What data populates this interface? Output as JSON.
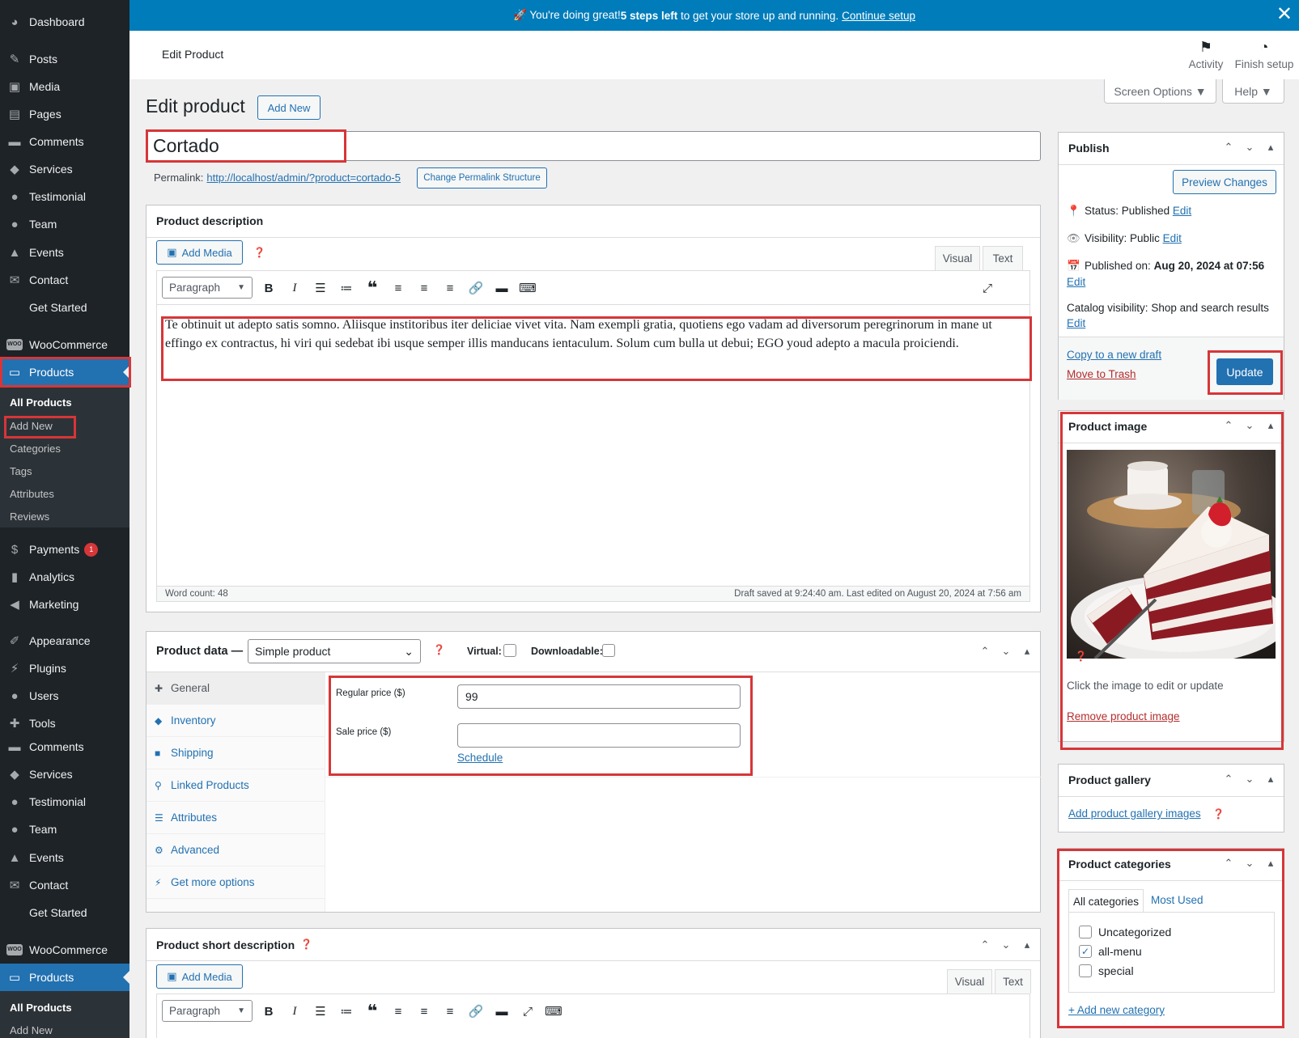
{
  "banner": {
    "text_prefix": "🚀 You're doing great! ",
    "text_bold": "5 steps left",
    "text_suffix": " to get your store up and running.",
    "link": "Continue setup"
  },
  "sidebar": {
    "top_items": [
      {
        "label": "Dashboard",
        "icon": "dashboard-icon"
      },
      {
        "label": "Posts",
        "icon": "pin-icon"
      },
      {
        "label": "Media",
        "icon": "media-icon"
      },
      {
        "label": "Pages",
        "icon": "pages-icon"
      },
      {
        "label": "Comments",
        "icon": "comment-icon"
      },
      {
        "label": "Services",
        "icon": "tag-icon"
      },
      {
        "label": "Testimonial",
        "icon": "user-icon"
      },
      {
        "label": "Team",
        "icon": "user-icon"
      },
      {
        "label": "Events",
        "icon": "graduation-icon"
      },
      {
        "label": "Contact",
        "icon": "mail-icon"
      },
      {
        "label": "Get Started",
        "icon": ""
      },
      {
        "label": "WooCommerce",
        "icon": "woo-icon"
      },
      {
        "label": "Products",
        "icon": "archive-icon"
      }
    ],
    "product_sub": [
      "All Products",
      "Add New",
      "Categories",
      "Tags",
      "Attributes",
      "Reviews"
    ],
    "bottom_items": [
      {
        "label": "Payments",
        "icon": "dollar-icon",
        "badge": "1"
      },
      {
        "label": "Analytics",
        "icon": "chart-icon"
      },
      {
        "label": "Marketing",
        "icon": "megaphone-icon"
      },
      {
        "label": "Appearance",
        "icon": "brush-icon"
      },
      {
        "label": "Plugins",
        "icon": "plug-icon"
      },
      {
        "label": "Users",
        "icon": "user-icon"
      },
      {
        "label": "Tools",
        "icon": "wrench-icon"
      },
      {
        "label": "Comments",
        "icon": "comment-icon"
      },
      {
        "label": "Services",
        "icon": "tag-icon"
      },
      {
        "label": "Testimonial",
        "icon": "user-icon"
      },
      {
        "label": "Team",
        "icon": "user-icon"
      },
      {
        "label": "Events",
        "icon": "graduation-icon"
      },
      {
        "label": "Contact",
        "icon": "mail-icon"
      },
      {
        "label": "Get Started",
        "icon": ""
      },
      {
        "label": "WooCommerce",
        "icon": "woo-icon"
      },
      {
        "label": "Products",
        "icon": "archive-icon"
      }
    ],
    "product_sub_bottom": [
      "All Products",
      "Add New"
    ]
  },
  "header": {
    "title": "Edit Product",
    "activity": "Activity",
    "finish_setup": "Finish setup",
    "screen_options": "Screen Options ▼",
    "help": "Help ▼"
  },
  "page": {
    "heading": "Edit product",
    "add_new": "Add New",
    "title_value": "Cortado",
    "permalink_label": "Permalink:",
    "permalink_url": "http://localhost/admin/?product=cortado-5",
    "change_permalink": "Change Permalink Structure"
  },
  "description_box": {
    "title": "Product description",
    "add_media": "Add Media",
    "tab_visual": "Visual",
    "tab_text": "Text",
    "format": "Paragraph",
    "content": "Te obtinuit ut adepto satis somno. Aliisque institoribus iter deliciae vivet vita. Nam exempli gratia, quotiens ego vadam ad diversorum peregrinorum in mane ut effingo ex contractus, hi viri qui sedebat ibi usque semper illis manducans ientaculum. Solum cum bulla ut debui; EGO youd adepto a macula proiciendi.",
    "word_count": "Word count: 48",
    "draft_saved": "Draft saved at 9:24:40 am. Last edited on August 20, 2024 at 7:56 am"
  },
  "product_data": {
    "title": "Product data —",
    "type": "Simple product",
    "virtual": "Virtual:",
    "downloadable": "Downloadable:",
    "tabs": [
      {
        "label": "General",
        "icon": "wrench-icon"
      },
      {
        "label": "Inventory",
        "icon": "diamond-icon"
      },
      {
        "label": "Shipping",
        "icon": "truck-icon"
      },
      {
        "label": "Linked Products",
        "icon": "link-icon"
      },
      {
        "label": "Attributes",
        "icon": "list-icon"
      },
      {
        "label": "Advanced",
        "icon": "gear-icon"
      },
      {
        "label": "Get more options",
        "icon": "plug-icon"
      }
    ],
    "regular_price_label": "Regular price ($)",
    "regular_price_value": "99",
    "sale_price_label": "Sale price ($)",
    "sale_price_value": "",
    "schedule": "Schedule"
  },
  "short_desc": {
    "title": "Product short description",
    "add_media": "Add Media",
    "tab_visual": "Visual",
    "tab_text": "Text",
    "format": "Paragraph"
  },
  "publish": {
    "title": "Publish",
    "preview": "Preview Changes",
    "status_label": "Status:",
    "status_value": "Published",
    "visibility_label": "Visibility:",
    "visibility_value": "Public",
    "published_label": "Published on:",
    "published_value": "Aug 20, 2024 at 07:56",
    "catalog_label": "Catalog visibility:",
    "catalog_value": "Shop and search results",
    "edit": "Edit",
    "copy_draft": "Copy to a new draft",
    "trash": "Move to Trash",
    "update": "Update"
  },
  "product_image": {
    "title": "Product image",
    "hint": "Click the image to edit or update",
    "remove": "Remove product image"
  },
  "gallery": {
    "title": "Product gallery",
    "add": "Add product gallery images"
  },
  "categories": {
    "title": "Product categories",
    "tab_all": "All categories",
    "tab_most": "Most Used",
    "items": [
      {
        "label": "Uncategorized",
        "checked": false
      },
      {
        "label": "all-menu",
        "checked": true
      },
      {
        "label": "special",
        "checked": false
      }
    ],
    "add_new": "+ Add new category"
  }
}
